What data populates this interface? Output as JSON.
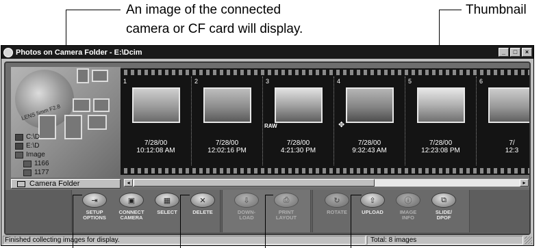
{
  "callouts": {
    "camera_image_line1": "An image of the connected",
    "camera_image_line2": "camera or CF card will display.",
    "thumbnail": "Thumbnail"
  },
  "window": {
    "title": "Photos on Camera Folder - E:\\Dcim",
    "minimize": "_",
    "maximize": "□",
    "close": "×"
  },
  "left_panel": {
    "lens_label": "LENS 5mm F2.8",
    "tree": [
      {
        "label": "C:\\D",
        "icon": "drive-icon"
      },
      {
        "label": "E:\\D",
        "icon": "drive-icon"
      },
      {
        "label": "Image",
        "icon": "folder-icon"
      },
      {
        "label": "1166",
        "icon": "folder-icon"
      },
      {
        "label": "1177",
        "icon": "folder-icon"
      }
    ],
    "folder_button": "Camera Folder"
  },
  "frames": [
    {
      "num": "1",
      "date": "7/28/00",
      "time": "10:12:08 AM",
      "raw": "",
      "color": "#9b9b9b"
    },
    {
      "num": "2",
      "date": "7/28/00",
      "time": "12:02:16 PM",
      "raw": "",
      "color": "#8d8d8d"
    },
    {
      "num": "3",
      "date": "7/28/00",
      "time": "4:21:30 PM",
      "raw": "RAW",
      "color": "#a3a3a3"
    },
    {
      "num": "4",
      "date": "7/28/00",
      "time": "9:32:43 AM",
      "raw": "",
      "color": "#858585"
    },
    {
      "num": "5",
      "date": "7/28/00",
      "time": "12:23:08 PM",
      "raw": "",
      "color": "#b0b0b0"
    },
    {
      "num": "6",
      "date": "7/",
      "time": "12:3",
      "raw": "",
      "color": "#999999"
    }
  ],
  "toolbar": {
    "setup": "SETUP\nOPTIONS",
    "connect": "CONNECT\nCAMERA",
    "select": "SELECT",
    "delete": "DELETE",
    "download": "DOWN-\nLOAD",
    "print": "PRINT\nLAYOUT",
    "rotate": "ROTATE",
    "upload": "UPLOAD",
    "image_info": "IMAGE\nINFO",
    "slide": "SLIDE/\nDPOF"
  },
  "status": {
    "left": "Finished collecting images for display.",
    "right": "Total: 8 images"
  }
}
